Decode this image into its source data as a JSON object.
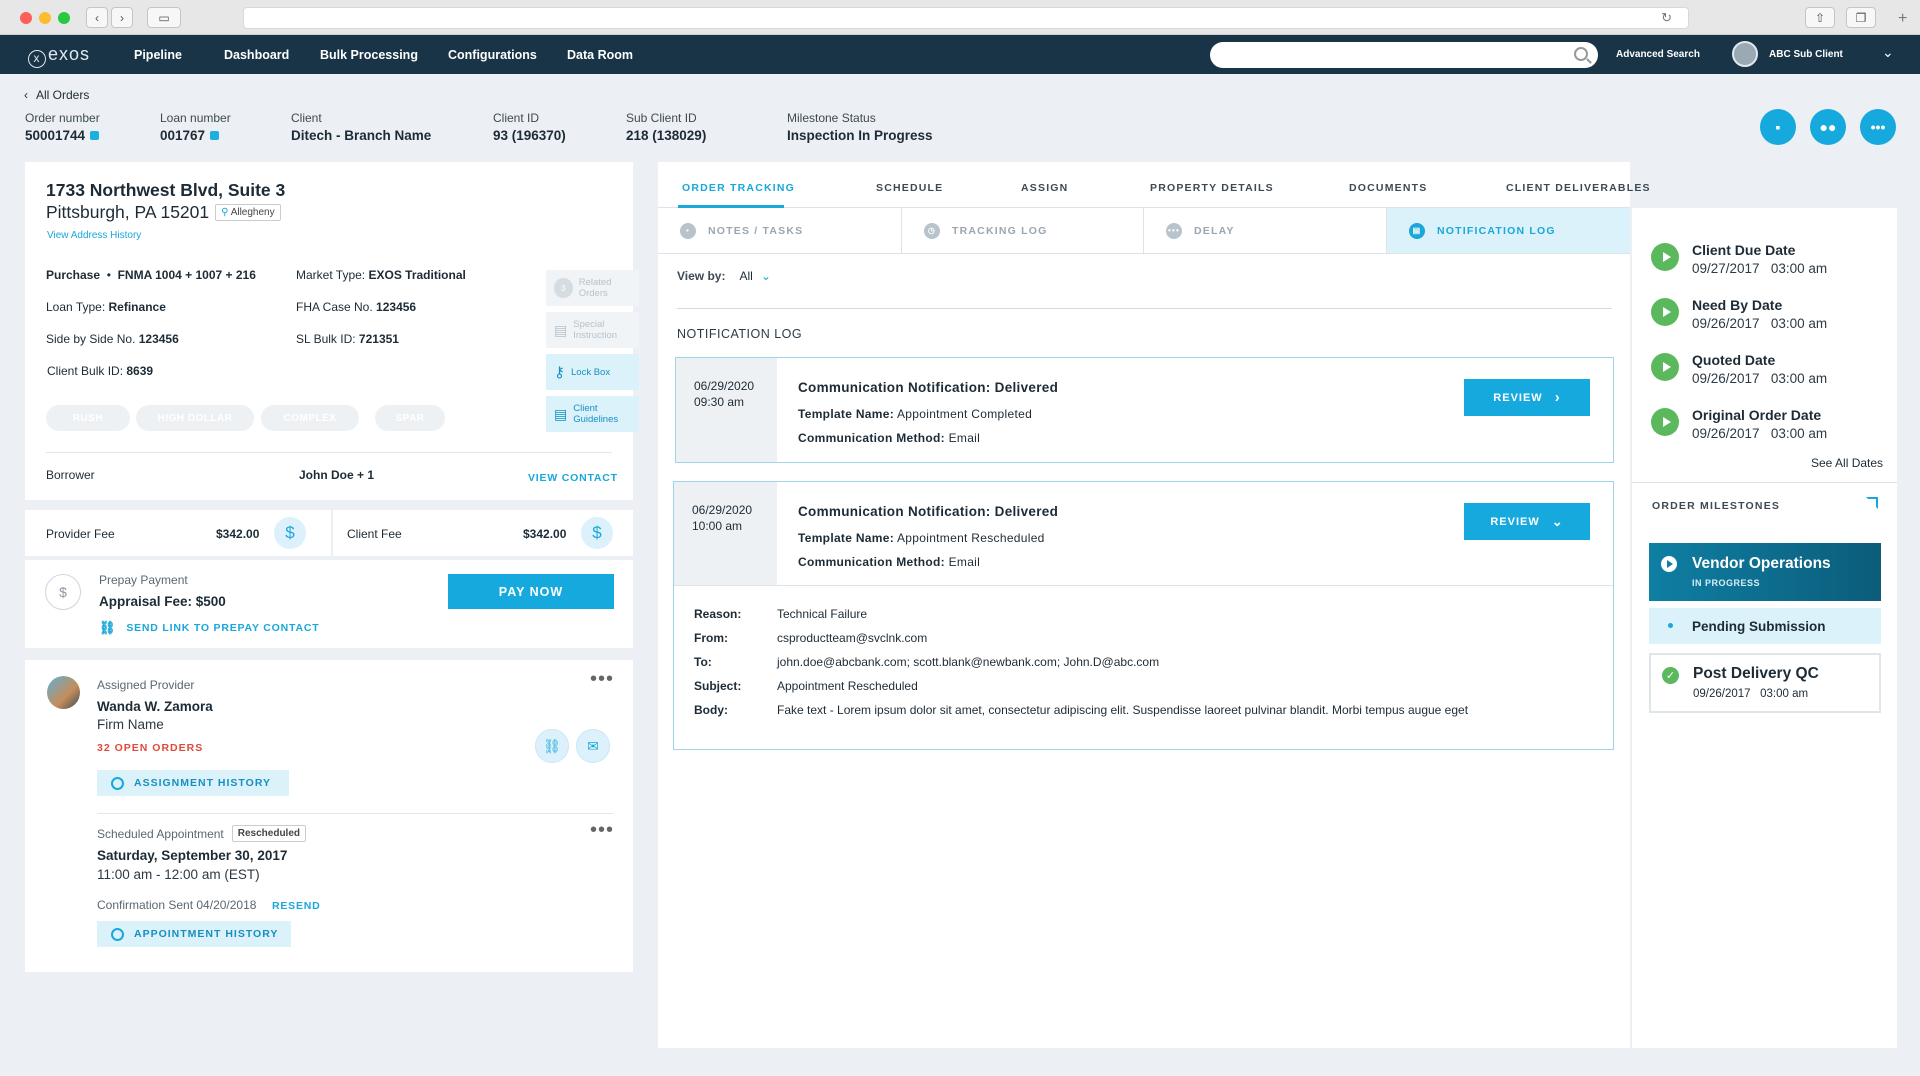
{
  "app": {
    "logo": "exos",
    "logo_mark": "x"
  },
  "nav": [
    "Pipeline",
    "Dashboard",
    "Bulk Processing",
    "Configurations",
    "Data Room"
  ],
  "search": {
    "placeholder": "",
    "advanced": "Advanced Search"
  },
  "user": {
    "name": "ABC Sub Client"
  },
  "back": {
    "label": "All Orders"
  },
  "header": {
    "fields": [
      {
        "label": "Order number",
        "value": "50001744"
      },
      {
        "label": "Loan number",
        "value": "001767"
      },
      {
        "label": "Client",
        "value": "Ditech - Branch Name"
      },
      {
        "label": "Client ID",
        "value": "93 (196370)"
      },
      {
        "label": "Sub Client ID",
        "value": "218 (138029)"
      },
      {
        "label": "Milestone Status",
        "value": "Inspection In Progress"
      }
    ]
  },
  "property": {
    "address1": "1733 Northwest Blvd, Suite 3",
    "address2": "Pittsburgh, PA 15201",
    "county": "Allegheny",
    "history_link": "View Address History",
    "purchase": "Purchase",
    "forms": "FNMA 1004 + 1007 + 216",
    "loan_type_label": "Loan Type:",
    "loan_type": "Refinance",
    "sbs_label": "Side by Side No.",
    "sbs": "123456",
    "bulk_label": "Client Bulk ID:",
    "bulk": "8639",
    "market_label": "Market Type:",
    "market": "EXOS Traditional",
    "fha_label": "FHA Case No.",
    "fha": "123456",
    "slbulk_label": "SL Bulk ID:",
    "slbulk": "721351",
    "tags": [
      "RUSH",
      "HIGH DOLLAR",
      "COMPLEX",
      "SPAR"
    ],
    "side_buttons": [
      {
        "label": "Related Orders",
        "count": "3"
      },
      {
        "label": "Special Instruction"
      },
      {
        "label": "Lock Box"
      },
      {
        "label": "Client Guidelines"
      }
    ],
    "borrower_label": "Borrower",
    "borrower": "John Doe + 1",
    "view_contact": "VIEW CONTACT"
  },
  "fees": {
    "provider_label": "Provider Fee",
    "provider": "$342.00",
    "client_label": "Client Fee",
    "client": "$342.00"
  },
  "prepay": {
    "label": "Prepay Payment",
    "fee": "Appraisal Fee: $500",
    "link": "SEND LINK TO PREPAY CONTACT",
    "button": "PAY NOW"
  },
  "provider": {
    "label": "Assigned Provider",
    "name": "Wanda W. Zamora",
    "firm": "Firm Name",
    "open_orders": "32 OPEN ORDERS",
    "history": "ASSIGNMENT HISTORY",
    "appt_label": "Scheduled Appointment",
    "appt_badge": "Rescheduled",
    "appt_date": "Saturday, September 30, 2017",
    "appt_time": "11:00 am - 12:00 am (EST)",
    "confirmation": "Confirmation Sent 04/20/2018",
    "resend": "RESEND",
    "appt_history": "APPOINTMENT HISTORY"
  },
  "tabs": [
    "ORDER TRACKING",
    "SCHEDULE",
    "ASSIGN",
    "PROPERTY DETAILS",
    "DOCUMENTS",
    "CLIENT DELIVERABLES"
  ],
  "subtabs": [
    "NOTES / TASKS",
    "TRACKING LOG",
    "DELAY",
    "NOTIFICATION LOG"
  ],
  "viewby": {
    "label": "View by:",
    "value": "All"
  },
  "log_title": "NOTIFICATION LOG",
  "notifications": [
    {
      "date": "06/29/2020",
      "time": "09:30 am",
      "title": "Communication Notification: Delivered",
      "template_label": "Template Name:",
      "template": "Appointment Completed",
      "method_label": "Communication Method:",
      "method": "Email",
      "button": "REVIEW"
    },
    {
      "date": "06/29/2020",
      "time": "10:00 am",
      "title": "Communication Notification: Delivered",
      "template_label": "Template Name:",
      "template": "Appointment Rescheduled",
      "method_label": "Communication Method:",
      "method": "Email",
      "button": "REVIEW",
      "details": [
        {
          "label": "Reason:",
          "value": "Technical Failure"
        },
        {
          "label": "From:",
          "value": "csproductteam@svclnk.com"
        },
        {
          "label": "To:",
          "value": "john.doe@abcbank.com; scott.blank@newbank.com; John.D@abc.com"
        },
        {
          "label": "Subject:",
          "value": "Appointment Rescheduled"
        },
        {
          "label": "Body:",
          "value": "Fake text - Lorem ipsum dolor sit amet, consectetur adipiscing elit. Suspendisse laoreet pulvinar blandit. Morbi tempus augue eget"
        }
      ]
    }
  ],
  "dates": [
    {
      "title": "Client Due Date",
      "value": "09/27/2017   03:00 am"
    },
    {
      "title": "Need By Date",
      "value": "09/26/2017   03:00 am"
    },
    {
      "title": "Quoted Date",
      "value": "09/26/2017   03:00 am"
    },
    {
      "title": "Original Order Date",
      "value": "09/26/2017   03:00 am"
    }
  ],
  "see_all": "See All Dates",
  "milestones": {
    "title": "ORDER MILESTONES",
    "active": {
      "name": "Vendor Operations",
      "status": "IN PROGRESS"
    },
    "pending": "Pending Submission",
    "done": {
      "name": "Post Delivery QC",
      "date": "09/26/2017   03:00 am"
    }
  },
  "colors": {
    "accent": "#15a9de",
    "nav": "#193447",
    "milestone": "#0e6c8a",
    "success": "#5cb85c",
    "alert": "#e04a3a"
  }
}
